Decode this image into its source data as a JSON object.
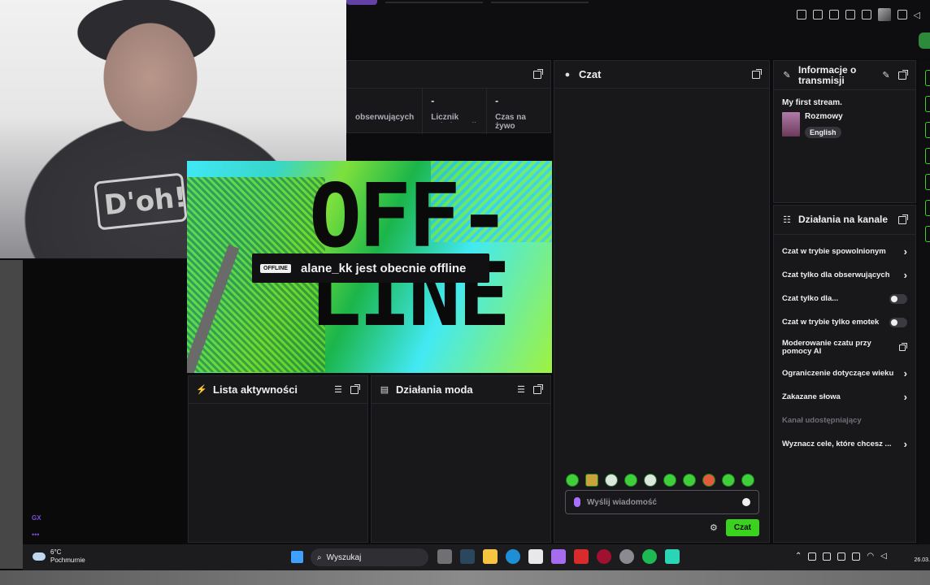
{
  "stats": {
    "items": [
      {
        "value": "",
        "label": "obserwujących"
      },
      {
        "value": "-",
        "label": "Licznik subskrypcji"
      },
      {
        "value": "-",
        "label": "Czas na żywo"
      }
    ]
  },
  "preview": {
    "art_text": "OFF-\nLINE",
    "badge": "OFFLINE",
    "message": "alane_kk jest obecnie offline"
  },
  "activity": {
    "title": "Lista aktywności"
  },
  "mod_actions": {
    "title": "Działania moda"
  },
  "chat": {
    "title": "Czat",
    "placeholder": "Wyślij wiadomość",
    "send_label": "Czat"
  },
  "stream_info": {
    "title": "Informacje o transmisji",
    "stream_title": "My first stream.",
    "category": "Rozmowy",
    "tag": "English"
  },
  "channel_actions": {
    "title": "Działania na kanale",
    "items": [
      {
        "label": "Czat w trybie spowolnionym",
        "control": "chevron"
      },
      {
        "label": "Czat tylko dla obserwujących",
        "control": "chevron"
      },
      {
        "label": "Czat tylko dla...",
        "control": "toggle"
      },
      {
        "label": "Czat w trybie tylko emotek",
        "control": "toggle"
      },
      {
        "label": "Moderowanie czatu przy pomocy AI",
        "control": "popout"
      },
      {
        "label": "Ograniczenie dotyczące wieku",
        "control": "chevron"
      },
      {
        "label": "Zakazane słowa",
        "control": "chevron"
      },
      {
        "label": "Kanał udostępniający",
        "control": "none"
      },
      {
        "label": "Wyznacz cele, które chcesz ...",
        "control": "chevron"
      }
    ]
  },
  "taskbar": {
    "temp": "6°C",
    "weather": "Pochmurnie",
    "search": "Wyszukaj",
    "date": "26.03."
  },
  "browser": {
    "gx_label": "GX"
  },
  "colors": {
    "accent": "#3bd11f",
    "brand": "#6441a5",
    "panel": "#18181b"
  }
}
